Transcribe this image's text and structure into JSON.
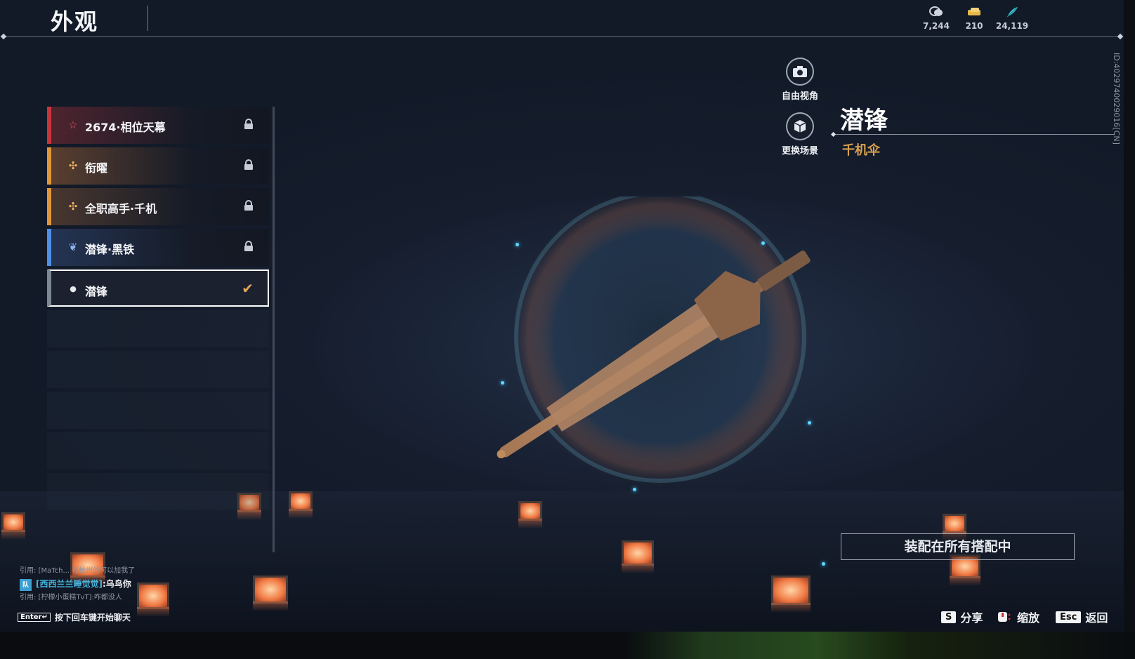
{
  "header": {
    "title": "外观",
    "currencies": [
      {
        "icon": "coin-stack-icon",
        "value": "7,244"
      },
      {
        "icon": "ticket-icon",
        "value": "210"
      },
      {
        "icon": "feather-icon",
        "value": "24,119"
      }
    ]
  },
  "skins": [
    {
      "label": "2674·相位天幕",
      "icon": "star-icon",
      "rarity_color": "#c9343b",
      "locked": true
    },
    {
      "label": "衔曜",
      "icon": "sparkle-icon",
      "rarity_color": "#e0973a",
      "locked": true
    },
    {
      "label": "全职高手·千机",
      "icon": "sparkle-icon",
      "rarity_color": "#e0973a",
      "locked": true
    },
    {
      "label": "潜锋·黑铁",
      "icon": "wings-icon",
      "rarity_color": "#4f8fe6",
      "locked": true
    },
    {
      "label": "潜锋",
      "icon": "drop-icon",
      "rarity_color": "#7d8796",
      "locked": false,
      "selected": true
    }
  ],
  "tools": {
    "free_camera": "自由视角",
    "change_scene": "更换场景"
  },
  "item": {
    "name": "潜锋",
    "type": "千机伞"
  },
  "id_text": "ID:4029740029016[CN]",
  "equip_button": "装配在所有搭配中",
  "chat": {
    "line1": "引用: [MaTch... 在杭州的可以加我了",
    "team": "[西西兰兰睡觉觉]",
    "team_badge": "队",
    "sender_msg": ":乌鸟你",
    "line3": "引用: [柠檬小蛋糕TvT]:咋都没人",
    "enter_key": "Enter↵",
    "enter_hint": "按下回车键开始聊天"
  },
  "hotkeys": {
    "share_key": "S",
    "share": "分享",
    "zoom": "缩放",
    "back_key": "Esc",
    "back": "返回"
  }
}
